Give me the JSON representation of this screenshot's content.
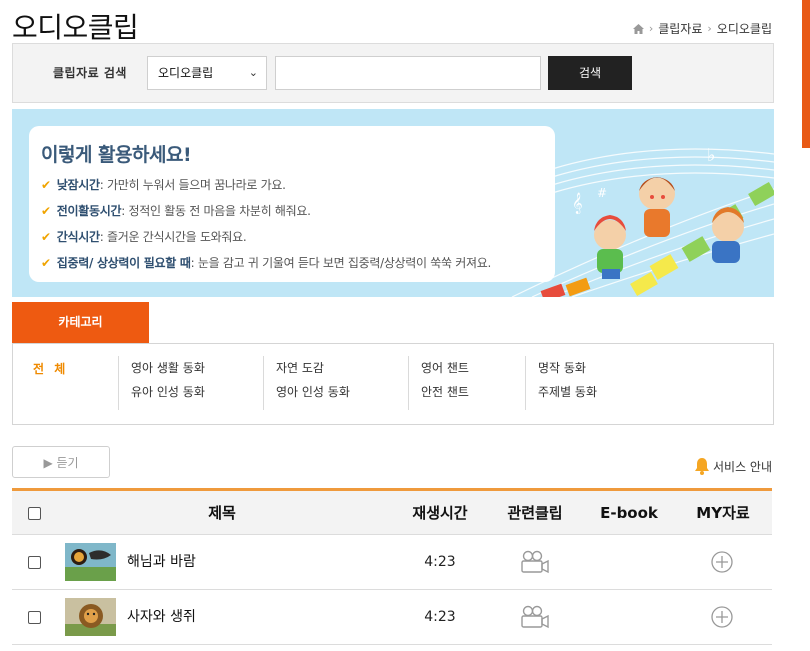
{
  "page": {
    "title": "오디오클립"
  },
  "breadcrumb": {
    "home_icon": "home-icon",
    "items": [
      "클립자료",
      "오디오클립"
    ]
  },
  "search": {
    "label": "클립자료 검색",
    "select_value": "오디오클립",
    "input_value": "",
    "button_label": "검색"
  },
  "banner": {
    "heading": "이렇게 활용하세요!",
    "tips": [
      {
        "label": "낮잠시간",
        "text": " : 가만히 누워서 들으며 꿈나라로 가요."
      },
      {
        "label": "전이활동시간",
        "text": " : 정적인 활동 전 마음을 차분히 해줘요."
      },
      {
        "label": "간식시간",
        "text": " : 즐거운 간식시간을 도와줘요."
      },
      {
        "label": "집중력/ 상상력이 필요할 때",
        "text": " : 눈을 감고 귀 기울여 듣다 보면 집중력/상상력이 쑥쑥 커져요."
      }
    ]
  },
  "category": {
    "tab_label": "카테고리",
    "all_label": "전 체",
    "columns": [
      [
        "영아 생활 동화",
        "유아 인성 동화"
      ],
      [
        "자연 도감",
        "영아 인성 동화"
      ],
      [
        "영어 챈트",
        "안전 챈트"
      ],
      [
        "명작 동화",
        "주제별 동화"
      ]
    ]
  },
  "toolbar": {
    "listen_label": "▶ 듣기",
    "service_label": "서비스 안내"
  },
  "table": {
    "headers": {
      "title": "제목",
      "duration": "재생시간",
      "related": "관련클립",
      "ebook": "E-book",
      "my": "MY자료"
    },
    "rows": [
      {
        "title": "해님과 바람",
        "duration": "4:23"
      },
      {
        "title": "사자와 생쥐",
        "duration": "4:23"
      }
    ]
  },
  "colors": {
    "accent": "#ee5a11",
    "header_border": "#ef9a3c",
    "banner_bg": "#bfe6f6",
    "highlight": "#ef8a00"
  }
}
